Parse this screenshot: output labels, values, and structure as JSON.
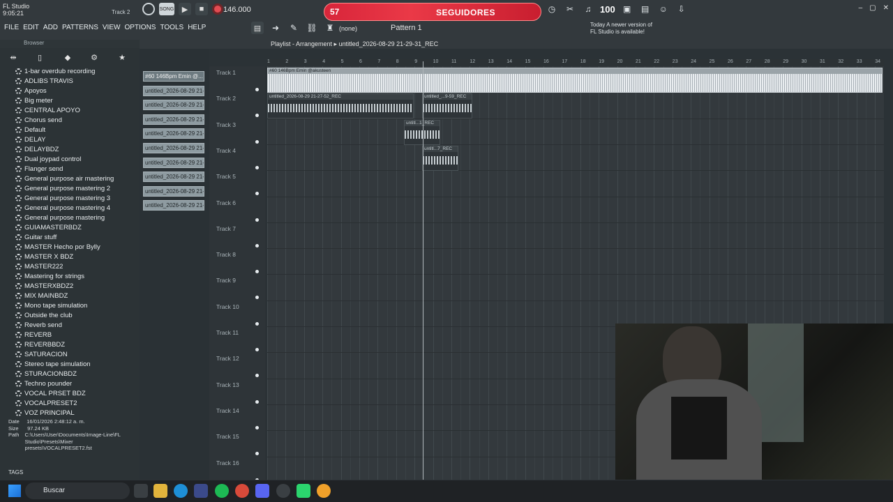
{
  "app": {
    "name": "FL Studio",
    "time": "9:05:21",
    "track": "Track 2",
    "tempo": "146.000",
    "mode": "SONG",
    "pattern": "Pattern 1",
    "pattern_sel": "(none)",
    "update_notice_line1": "Today  A newer version of",
    "update_notice_line2": "FL Studio is available!",
    "counter": "100"
  },
  "banner": {
    "number": "57",
    "label": "SEGUIDORES"
  },
  "menu": [
    "FILE",
    "EDIT",
    "ADD",
    "PATTERNS",
    "VIEW",
    "OPTIONS",
    "TOOLS",
    "HELP"
  ],
  "browser": {
    "title": "Browser",
    "items": [
      "1-bar overdub recording",
      "ADLIBS TRAVIS",
      "Apoyos",
      "Big meter",
      "CENTRAL APOYO",
      "Chorus send",
      "Default",
      "DELAY",
      "DELAYBDZ",
      "Dual joypad control",
      "Flanger send",
      "General purpose air mastering",
      "General purpose mastering 2",
      "General purpose mastering 3",
      "General purpose mastering 4",
      "General purpose mastering",
      "GUIAMASTERBDZ",
      "Guitar stuff",
      "MASTER Hecho por Bylly",
      "MASTER X BDZ",
      "MASTER222",
      "Mastering for strings",
      "MASTERXBDZ2",
      "MIX MAINBDZ",
      "Mono tape simulation",
      "Outside the club",
      "Reverb send",
      "REVERB",
      "REVERBBDZ",
      "SATURACION",
      "Stereo tape simulation",
      "STURACIONBDZ",
      "Techno pounder",
      "VOCAL PRSET BDZ",
      "VOCALPRESET2",
      "VOZ PRINCIPAL"
    ],
    "info": {
      "date_label": "Date",
      "date": "16/01/2026 2:48:12 a. m.",
      "size_label": "Size",
      "size": "97.24 KB",
      "path_label": "Path",
      "path": "C:\\Users\\User\\Documents\\Image-Line\\FL Studio\\Presets\\Mixer presets\\VOCALPRESET2.fst"
    },
    "tags": "TAGS"
  },
  "clips": [
    "#60 146Bpm Emin @...",
    "untitled_2026-08-29 21-...",
    "untitled_2026-08-29 21-...",
    "untitled_2026-08-29 21-...",
    "untitled_2026-08-29 21-...",
    "untitled_2026-08-29 21-...",
    "untitled_2026-08-29 21-...",
    "untitled_2026-08-29 21-...",
    "untitled_2026-08-29 21-...",
    "untitled_2026-08-29 21-..."
  ],
  "playlist": {
    "title": "Playlist - Arrangement",
    "file": "untitled_2026-08-29 21-29-31_REC",
    "tracks": [
      "Track 1",
      "Track 2",
      "Track 3",
      "Track 4",
      "Track 5",
      "Track 6",
      "Track 7",
      "Track 8",
      "Track 9",
      "Track 10",
      "Track 11",
      "Track 12",
      "Track 13",
      "Track 14",
      "Track 15",
      "Track 16"
    ],
    "ruler": [
      "1",
      "2",
      "3",
      "4",
      "5",
      "6",
      "7",
      "8",
      "9",
      "10",
      "11",
      "12",
      "13",
      "14",
      "15",
      "16",
      "17",
      "18",
      "19",
      "20",
      "21",
      "22",
      "23",
      "24",
      "25",
      "26",
      "27",
      "28",
      "29",
      "30",
      "31",
      "32",
      "33",
      "34"
    ],
    "audio": [
      {
        "label": "#60 146Bpm Emin @akusteen"
      },
      {
        "label": "untitled_2026-08-29 21-27-52_REC"
      },
      {
        "label": "untitled_...9-59_REC"
      },
      {
        "label": "untitl...1_REC"
      },
      {
        "label": "untitl...7_REC"
      }
    ]
  },
  "taskbar": {
    "search": "Buscar"
  }
}
